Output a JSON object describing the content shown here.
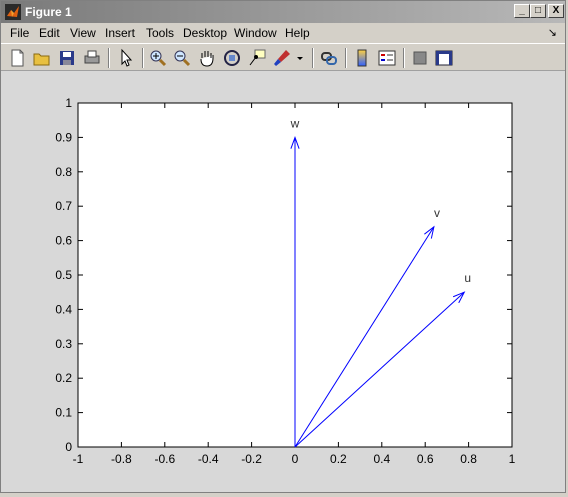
{
  "window": {
    "title": "Figure 1",
    "minimize_glyph": "_",
    "maximize_glyph": "□",
    "close_glyph": "X"
  },
  "menu": {
    "items": [
      "File",
      "Edit",
      "View",
      "Insert",
      "Tools",
      "Desktop",
      "Window",
      "Help"
    ],
    "dock_glyph": "↘"
  },
  "toolbar": {
    "buttons": [
      "new-figure-icon",
      "open-file-icon",
      "save-icon",
      "print-icon",
      "edit-plot-arrow-icon",
      "zoom-in-icon",
      "zoom-out-icon",
      "pan-hand-icon",
      "rotate-3d-icon",
      "data-cursor-icon",
      "brush-icon",
      "link-plot-icon",
      "colorbar-icon",
      "legend-icon",
      "hide-plot-tools-icon",
      "show-plot-tools-icon"
    ]
  },
  "chart_data": {
    "type": "quiver",
    "xlim": [
      -1,
      1
    ],
    "ylim": [
      0,
      1
    ],
    "xticks": [
      "-1",
      "-0.8",
      "-0.6",
      "-0.4",
      "-0.2",
      "0",
      "0.2",
      "0.4",
      "0.6",
      "0.8",
      "1"
    ],
    "yticks": [
      "0",
      "0.1",
      "0.2",
      "0.3",
      "0.4",
      "0.5",
      "0.6",
      "0.7",
      "0.8",
      "0.9",
      "1"
    ],
    "grid": false,
    "color": "#0000ff",
    "vectors": [
      {
        "label": "u",
        "x0": 0,
        "y0": 0,
        "x": 0.78,
        "y": 0.45
      },
      {
        "label": "v",
        "x0": 0,
        "y0": 0,
        "x": 0.64,
        "y": 0.64
      },
      {
        "label": "w",
        "x0": 0,
        "y0": 0,
        "x": 0.0,
        "y": 0.9
      }
    ]
  }
}
